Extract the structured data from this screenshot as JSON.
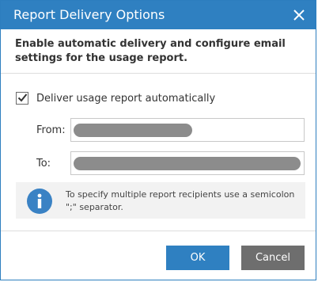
{
  "dialog": {
    "title": "Report Delivery Options",
    "heading": "Enable automatic delivery and configure email settings for the usage report.",
    "auto_delivery": {
      "label": "Deliver usage report automatically",
      "checked": true
    },
    "from_label": "From:",
    "to_label": "To:",
    "info_text": "To specify multiple report recipients use a semicolon \";\" separator.",
    "ok_label": "OK",
    "cancel_label": "Cancel"
  },
  "icons": {
    "close": "close-icon",
    "check": "check-icon",
    "info": "info-icon"
  },
  "colors": {
    "titlebar": "#2f80c1",
    "primary_button": "#2f80c1",
    "secondary_button": "#6e6e6e",
    "info_icon": "#3a82c4"
  }
}
